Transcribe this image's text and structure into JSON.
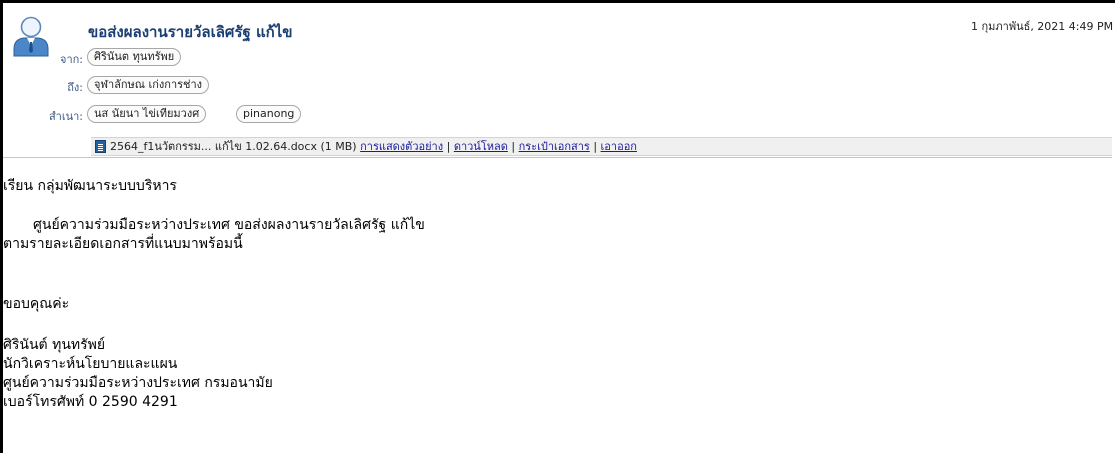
{
  "email": {
    "subject": "ขอส่งผลงานรายวัลเลิศรัฐ แก้ไข",
    "date": "1 กุมภาพันธ์, 2021 4:49 PM",
    "from_label": "จาก:",
    "from": "ศิรินันต ทุนทรัพย",
    "to_label": "ถึง:",
    "to": "จุฬาลักษณ เก่งการช่าง",
    "cc_label": "สำเนา:",
    "cc": [
      "นส นัยนา ไข่เทียมวงศ",
      "pinanong"
    ]
  },
  "attachment": {
    "filename": "2564_f1นวัตกรรม... แก้ไข 1.02.64.docx",
    "size": "(1 MB)",
    "actions": [
      "การแสดงตัวอย่าง",
      "ดาวน์โหลด",
      "กระเป๋าเอกสาร",
      "เอาออก"
    ],
    "separator": "|"
  },
  "body": {
    "greeting": "เรียน กลุ่มพัฒนาระบบบริหาร",
    "para_line1": "ศูนย์ความร่วมมือระหว่างประเทศ  ขอส่งผลงานรายวัลเลิศรัฐ แก้ไข",
    "para_line2": "ตามรายละเอียดเอกสารที่แนบมาพร้อมนี้",
    "thanks": "ขอบคุณค่ะ",
    "signature": [
      "ศิรินันต์  ทุนทรัพย์",
      "นักวิเคราะห์นโยบายและแผน",
      "ศูนย์ความร่วมมือระหว่างประเทศ กรมอนามัย",
      "เบอร์โทรศัพท์ 0 2590 4291"
    ]
  },
  "colors": {
    "subject": "#1c3f73",
    "label": "#3a5a85",
    "link": "#1a1a9a",
    "attach_bar": "#f0f0f0"
  },
  "icons": {
    "avatar": "person-avatar-icon",
    "attachment": "word-document-icon"
  }
}
